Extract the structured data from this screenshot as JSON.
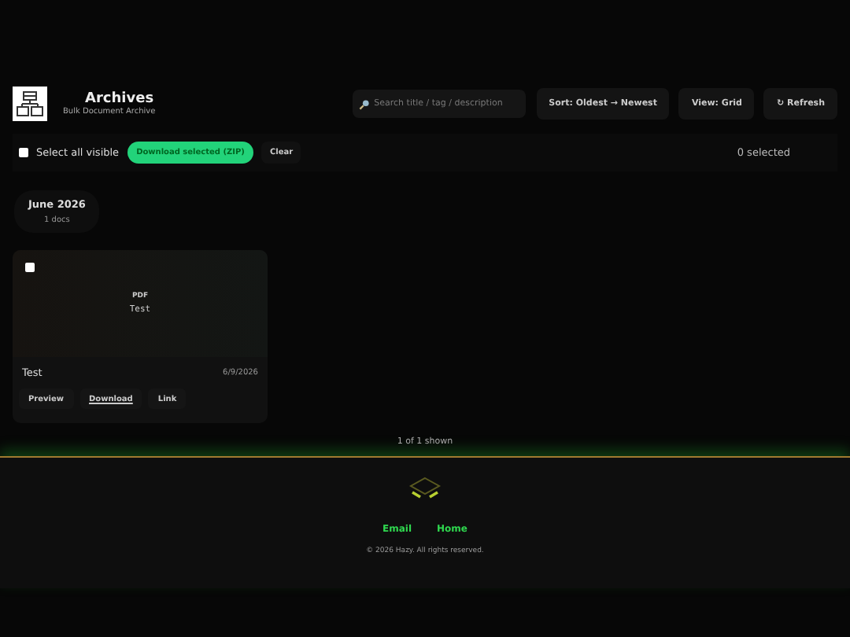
{
  "header": {
    "title": "Archives",
    "subtitle": "Bulk Document Archive",
    "search": {
      "placeholder": "Search title / tag / description"
    },
    "buttons": [
      "Sort: Oldest → Newest",
      "View: Grid",
      "↻ Refresh"
    ]
  },
  "bulk_bar": {
    "select_all": {
      "label": "Select all visible",
      "checked": false
    },
    "download_button": "Download selected (ZIP)",
    "clear_button": "Clear",
    "selected_count": "0 selected"
  },
  "groups": [
    {
      "title": "June 2026",
      "count": "1 docs",
      "documents": [
        {
          "type_label": "PDF",
          "preview_title": "Test",
          "title": "Test",
          "date": "6/9/2026",
          "checked": false,
          "actions": [
            "Preview",
            "Download",
            "Link"
          ]
        }
      ]
    }
  ],
  "shown_count": "1 of 1 shown",
  "footer": {
    "links": [
      "Email",
      "Home"
    ],
    "copyright": "© 2026 Hazy. All rights reserved."
  }
}
